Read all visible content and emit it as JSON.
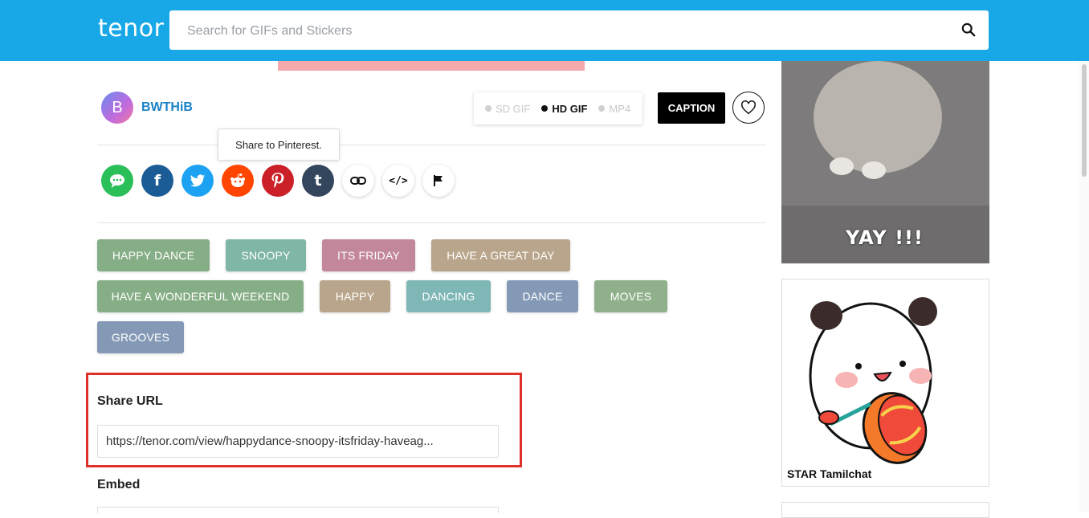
{
  "header": {
    "logo": "tenor",
    "search_placeholder": "Search for GIFs and Stickers",
    "search_icon": "search-icon"
  },
  "author": {
    "initial": "B",
    "name": "BWTHiB"
  },
  "quality": {
    "options": [
      "SD GIF",
      "HD GIF",
      "MP4"
    ],
    "selected": "HD GIF"
  },
  "actions": {
    "caption_label": "CAPTION",
    "favorite_icon": "heart-icon"
  },
  "tooltip": "Share to Pinterest.",
  "share_buttons": [
    {
      "name": "message",
      "icon": "message-icon",
      "color": "#2bbf5a"
    },
    {
      "name": "facebook",
      "icon": "facebook-icon",
      "color": "#1b5c96"
    },
    {
      "name": "twitter",
      "icon": "twitter-icon",
      "color": "#1da1f2"
    },
    {
      "name": "reddit",
      "icon": "reddit-icon",
      "color": "#ff4500"
    },
    {
      "name": "pinterest",
      "icon": "pinterest-icon",
      "color": "#cb2027"
    },
    {
      "name": "tumblr",
      "icon": "tumblr-icon",
      "color": "#34465d"
    },
    {
      "name": "copy-link",
      "icon": "link-icon",
      "color": "#ffffff"
    },
    {
      "name": "embed",
      "icon": "code-icon",
      "color": "#ffffff"
    },
    {
      "name": "report",
      "icon": "flag-icon",
      "color": "#ffffff"
    }
  ],
  "tags": [
    {
      "label": "HAPPY DANCE",
      "color": "#86ae86"
    },
    {
      "label": "SNOOPY",
      "color": "#7fb6a6"
    },
    {
      "label": "ITS FRIDAY",
      "color": "#c2879a"
    },
    {
      "label": "HAVE A GREAT DAY",
      "color": "#b9a58b"
    },
    {
      "label": "HAVE A WONDERFUL WEEKEND",
      "color": "#86ae86"
    },
    {
      "label": "HAPPY",
      "color": "#b9a58b"
    },
    {
      "label": "DANCING",
      "color": "#7fb6b6"
    },
    {
      "label": "DANCE",
      "color": "#8499b6"
    },
    {
      "label": "MOVES",
      "color": "#8fb08a"
    },
    {
      "label": "GROOVES",
      "color": "#8499b6"
    }
  ],
  "share_url": {
    "label": "Share URL",
    "value": "https://tenor.com/view/happydance-snoopy-itsfriday-haveag..."
  },
  "embed": {
    "label": "Embed"
  },
  "sidebar": {
    "gif1_caption": "YAY !!!",
    "gif2_watermark": "STAR Tamilchat"
  }
}
